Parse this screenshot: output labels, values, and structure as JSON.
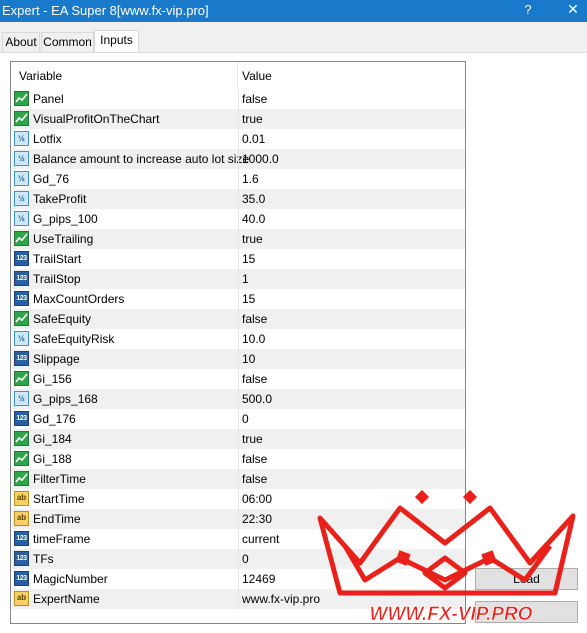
{
  "window": {
    "title": "Expert - EA Super 8[www.fx-vip.pro]",
    "help": "?",
    "close": "✕"
  },
  "tabs": [
    {
      "label": "About"
    },
    {
      "label": "Common"
    },
    {
      "label": "Inputs"
    }
  ],
  "grid": {
    "columns": {
      "variable": "Variable",
      "value": "Value"
    },
    "rows": [
      {
        "name": "Panel",
        "value": "false",
        "type": "bool"
      },
      {
        "name": "VisualProfitOnTheChart",
        "value": "true",
        "type": "bool"
      },
      {
        "name": "Lotfix",
        "value": "0.01",
        "type": "double"
      },
      {
        "name": "Balance amount to increase auto lot size",
        "value": "1000.0",
        "type": "double"
      },
      {
        "name": "Gd_76",
        "value": "1.6",
        "type": "double"
      },
      {
        "name": "TakeProfit",
        "value": "35.0",
        "type": "double"
      },
      {
        "name": "G_pips_100",
        "value": "40.0",
        "type": "double"
      },
      {
        "name": "UseTrailing",
        "value": "true",
        "type": "bool"
      },
      {
        "name": "TrailStart",
        "value": "15",
        "type": "int"
      },
      {
        "name": "TrailStop",
        "value": "1",
        "type": "int"
      },
      {
        "name": "MaxCountOrders",
        "value": "15",
        "type": "int"
      },
      {
        "name": "SafeEquity",
        "value": "false",
        "type": "bool"
      },
      {
        "name": "SafeEquityRisk",
        "value": "10.0",
        "type": "double"
      },
      {
        "name": "Slippage",
        "value": "10",
        "type": "int"
      },
      {
        "name": "Gi_156",
        "value": "false",
        "type": "bool"
      },
      {
        "name": "G_pips_168",
        "value": "500.0",
        "type": "double"
      },
      {
        "name": "Gd_176",
        "value": "0",
        "type": "int"
      },
      {
        "name": "Gi_184",
        "value": "true",
        "type": "bool"
      },
      {
        "name": "Gi_188",
        "value": "false",
        "type": "bool"
      },
      {
        "name": "FilterTime",
        "value": "false",
        "type": "bool"
      },
      {
        "name": "StartTime",
        "value": "06:00",
        "type": "string"
      },
      {
        "name": "EndTime",
        "value": "22:30",
        "type": "string"
      },
      {
        "name": "timeFrame",
        "value": "current",
        "type": "int"
      },
      {
        "name": "TFs",
        "value": "0",
        "type": "int"
      },
      {
        "name": "MagicNumber",
        "value": "12469",
        "type": "int"
      },
      {
        "name": "ExpertName",
        "value": "www.fx-vip.pro",
        "type": "string"
      }
    ]
  },
  "icon_glyphs": {
    "double": "½",
    "int": "123",
    "string": "ab",
    "bool": "bool-chart-icon"
  },
  "buttons": {
    "load": "Load",
    "save": ""
  },
  "watermark": {
    "text": "WWW.FX-VIP.PRO",
    "color": "#e8221b"
  },
  "colors": {
    "titlebar": "#1979ca",
    "row_alt": "#f0f0f0"
  }
}
